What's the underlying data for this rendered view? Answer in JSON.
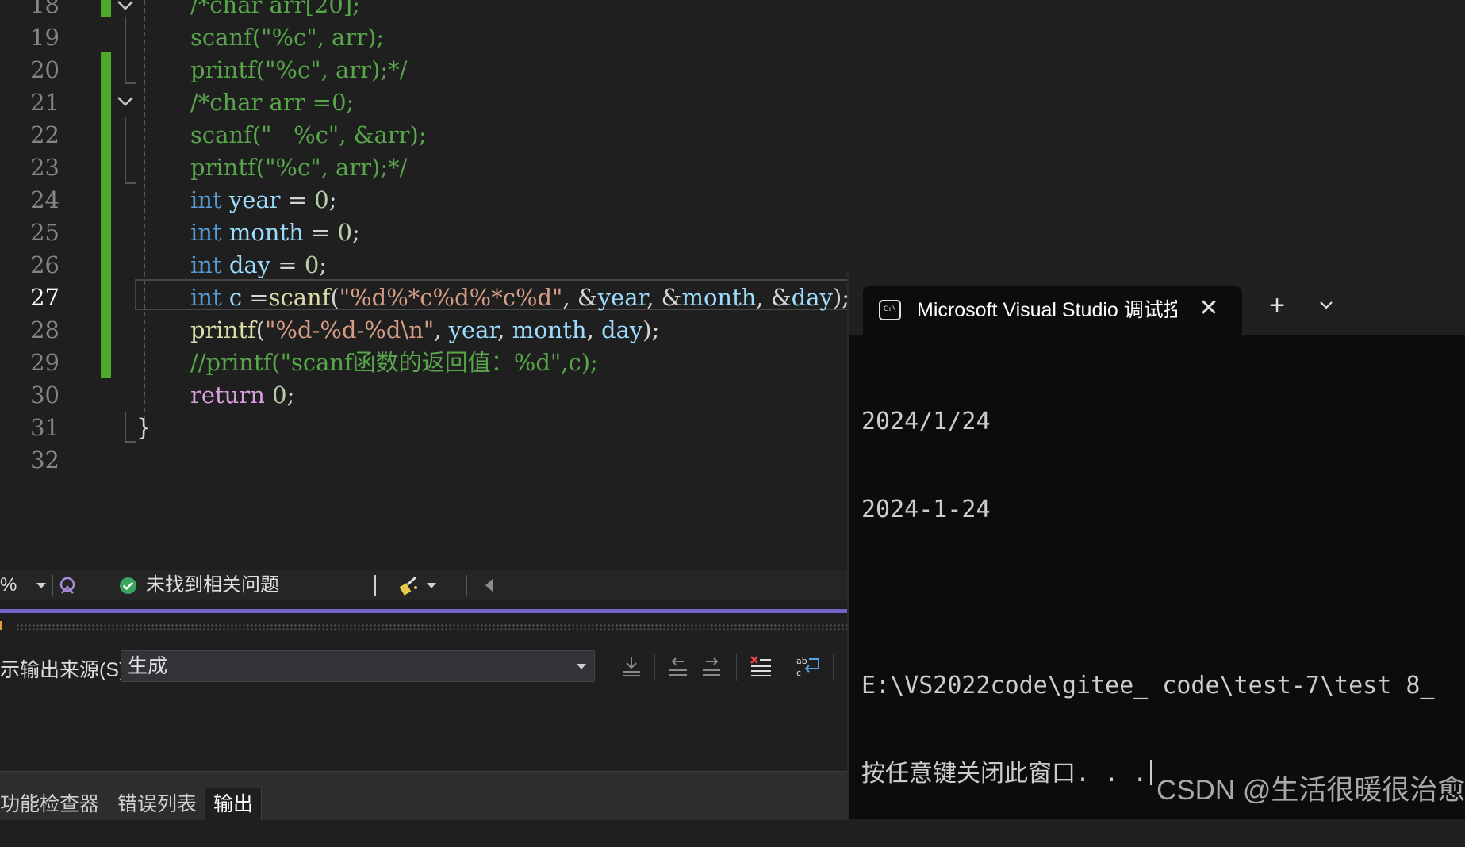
{
  "editor": {
    "lines": [
      {
        "n": "18",
        "tokens": [
          {
            "c": "cmt",
            "t": "/*char arr[20];"
          }
        ]
      },
      {
        "n": "19",
        "tokens": [
          {
            "c": "cmt",
            "t": "scanf(\"%c\", arr);"
          }
        ]
      },
      {
        "n": "20",
        "tokens": [
          {
            "c": "cmt",
            "t": "printf(\"%c\", arr);*/"
          }
        ]
      },
      {
        "n": "21",
        "tokens": [
          {
            "c": "cmt",
            "t": "/*char arr =0;"
          }
        ]
      },
      {
        "n": "22",
        "tokens": [
          {
            "c": "cmt",
            "t": "scanf(\"   %c\", &arr);"
          }
        ]
      },
      {
        "n": "23",
        "tokens": [
          {
            "c": "cmt",
            "t": "printf(\"%c\", arr);*/"
          }
        ]
      },
      {
        "n": "24",
        "tokens": [
          {
            "c": "kw",
            "t": "int"
          },
          {
            "c": "plain",
            "t": " "
          },
          {
            "c": "var",
            "t": "year"
          },
          {
            "c": "plain",
            "t": " = "
          },
          {
            "c": "num",
            "t": "0"
          },
          {
            "c": "plain",
            "t": ";"
          }
        ]
      },
      {
        "n": "25",
        "tokens": [
          {
            "c": "kw",
            "t": "int"
          },
          {
            "c": "plain",
            "t": " "
          },
          {
            "c": "var",
            "t": "month"
          },
          {
            "c": "plain",
            "t": " = "
          },
          {
            "c": "num",
            "t": "0"
          },
          {
            "c": "plain",
            "t": ";"
          }
        ]
      },
      {
        "n": "26",
        "tokens": [
          {
            "c": "kw",
            "t": "int"
          },
          {
            "c": "plain",
            "t": " "
          },
          {
            "c": "var",
            "t": "day"
          },
          {
            "c": "plain",
            "t": " = "
          },
          {
            "c": "num",
            "t": "0"
          },
          {
            "c": "plain",
            "t": ";"
          }
        ]
      },
      {
        "n": "27",
        "current": true,
        "tokens": [
          {
            "c": "kw",
            "t": "int"
          },
          {
            "c": "plain",
            "t": " "
          },
          {
            "c": "var",
            "t": "c"
          },
          {
            "c": "plain",
            "t": " ="
          },
          {
            "c": "fn",
            "t": "scanf"
          },
          {
            "c": "plain",
            "t": "("
          },
          {
            "c": "str",
            "t": "\"%d%*c%d%*c%d\""
          },
          {
            "c": "plain",
            "t": ", &"
          },
          {
            "c": "var",
            "t": "year"
          },
          {
            "c": "plain",
            "t": ", &"
          },
          {
            "c": "var",
            "t": "month"
          },
          {
            "c": "plain",
            "t": ", &"
          },
          {
            "c": "var",
            "t": "day"
          },
          {
            "c": "plain",
            "t": ");"
          }
        ]
      },
      {
        "n": "28",
        "tokens": [
          {
            "c": "fn",
            "t": "printf"
          },
          {
            "c": "plain",
            "t": "("
          },
          {
            "c": "str",
            "t": "\"%d-%d-%d\\n\""
          },
          {
            "c": "plain",
            "t": ", "
          },
          {
            "c": "var",
            "t": "year"
          },
          {
            "c": "plain",
            "t": ", "
          },
          {
            "c": "var",
            "t": "month"
          },
          {
            "c": "plain",
            "t": ", "
          },
          {
            "c": "var",
            "t": "day"
          },
          {
            "c": "plain",
            "t": ");"
          }
        ]
      },
      {
        "n": "29",
        "tokens": [
          {
            "c": "cmt",
            "t": "//printf(\"scanf函数的返回值：%d\",c);"
          }
        ]
      },
      {
        "n": "30",
        "tokens": [
          {
            "c": "kw2",
            "t": "return"
          },
          {
            "c": "plain",
            "t": " "
          },
          {
            "c": "num",
            "t": "0"
          },
          {
            "c": "plain",
            "t": ";"
          }
        ]
      },
      {
        "n": "31",
        "tokens": [
          {
            "c": "plain",
            "t": "}"
          }
        ],
        "indent": "close"
      },
      {
        "n": "32",
        "tokens": []
      }
    ]
  },
  "statusbar": {
    "zoom": "%",
    "issues_text": "未找到相关问题"
  },
  "output": {
    "source_label": "示输出来源(S):",
    "source_value": "生成",
    "tabs": [
      "功能检查器",
      "错误列表",
      "输出"
    ],
    "active_tab": "输出"
  },
  "terminal": {
    "tab_title": "Microsoft Visual Studio 调试控制台",
    "icon_glyph": "C:\\",
    "output_lines": [
      "2024/1/24",
      "2024-1-24",
      "",
      "E:\\VS2022code\\gitee_ code\\test-7\\test 8_",
      "按任意键关闭此窗口. . ."
    ]
  },
  "watermark": "CSDN @生活很暖很治愈",
  "colors": {
    "editor_bg": "#1f1f1f",
    "keyword": "#569cd6",
    "comment": "#57a64a",
    "string": "#d69d85",
    "change_bar": "#4ea82a",
    "accent": "#7163c7",
    "terminal_bg": "#0c0c0c"
  }
}
